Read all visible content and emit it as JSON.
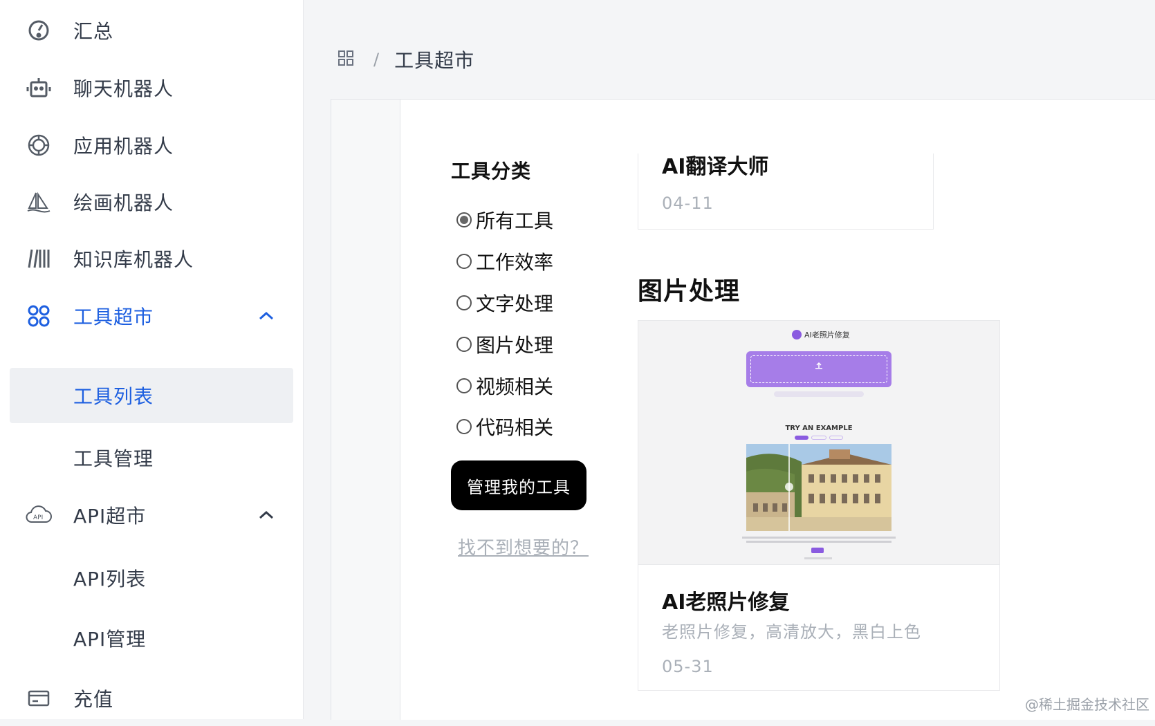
{
  "sidebar": {
    "items": [
      {
        "label": "汇总",
        "icon": "dashboard-icon"
      },
      {
        "label": "聊天机器人",
        "icon": "robot-icon"
      },
      {
        "label": "应用机器人",
        "icon": "openai-icon"
      },
      {
        "label": "绘画机器人",
        "icon": "sailboat-icon"
      },
      {
        "label": "知识库机器人",
        "icon": "library-icon"
      },
      {
        "label": "工具超市",
        "icon": "apps-icon",
        "expanded": true,
        "active": true
      },
      {
        "label": "工具列表",
        "sub": true,
        "selected": true
      },
      {
        "label": "工具管理",
        "sub": true
      },
      {
        "label": "API超市",
        "icon": "api-cloud-icon",
        "expanded": true
      },
      {
        "label": "API列表",
        "sub": true
      },
      {
        "label": "API管理",
        "sub": true
      },
      {
        "label": "充值",
        "icon": "credit-card-icon"
      }
    ]
  },
  "breadcrumb": {
    "home_icon": "grid-icon",
    "separator": "/",
    "current": "工具超市"
  },
  "filter": {
    "title": "工具分类",
    "options": [
      {
        "label": "所有工具",
        "checked": true
      },
      {
        "label": "工作效率",
        "checked": false
      },
      {
        "label": "文字处理",
        "checked": false
      },
      {
        "label": "图片处理",
        "checked": false
      },
      {
        "label": "视频相关",
        "checked": false
      },
      {
        "label": "代码相关",
        "checked": false
      }
    ],
    "manage_button": "管理我的工具",
    "not_found_link": "找不到想要的？"
  },
  "cards": {
    "top": {
      "title": "AI翻译大师",
      "date": "04-11"
    },
    "section_title": "图片处理",
    "photo": {
      "thumb_app_title": "AI老照片修复",
      "thumb_example": "TRY AN EXAMPLE",
      "title": "AI老照片修复",
      "description": "老照片修复，高清放大，黑白上色",
      "date": "05-31"
    }
  },
  "watermark": "@稀土掘金技术社区",
  "colors": {
    "accent": "#1d5fe0",
    "thumb_purple": "#a67de8",
    "button_black": "#000000"
  }
}
